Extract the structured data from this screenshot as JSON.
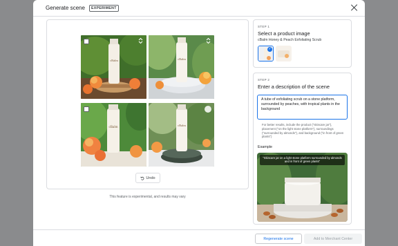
{
  "dialog": {
    "title": "Generate scene",
    "badge": "EXPERIMENT",
    "close_icon": "close-icon"
  },
  "preview": {
    "undo_label": "Undo",
    "undo_icon": "undo-icon",
    "tiles": [
      {
        "scene": "round wooden platform with peaches",
        "selected": false
      },
      {
        "scene": "light stone platform with peaches",
        "selected": false
      },
      {
        "scene": "peaches arranged around product",
        "selected": false
      },
      {
        "scene": "dark stone platform with peaches",
        "selected": false
      }
    ],
    "product_brand": "cBalm",
    "experimental_note": "This feature is experimental, and results may vary"
  },
  "step1": {
    "step_label": "STEP 1",
    "title": "Select a product image",
    "product_name": "cBalm Honey & Peach Exfoliating Scrub"
  },
  "step2": {
    "step_label": "STEP 2",
    "title": "Enter a description of the scene",
    "description_value": "A tube of exfoliating scrub on a stone platform, surrounded by peaches, with tropical plants in the background",
    "helper_text": "For better results, include the product (\"skincare jar\"), placement (\"on the light stone platform\"), surroundings (\"surrounded by almonds\"), and background (\"in front of green plants\")",
    "example_label": "Example",
    "example_caption": "\"Skincare jar on a light stone platform surrounded by almonds and in front of green plants\""
  },
  "footer": {
    "regenerate_label": "Regenerate scene",
    "add_label": "Add to Merchant Center"
  },
  "colors": {
    "accent": "#1a73e8",
    "disabled_bg": "#f1f3f4"
  }
}
